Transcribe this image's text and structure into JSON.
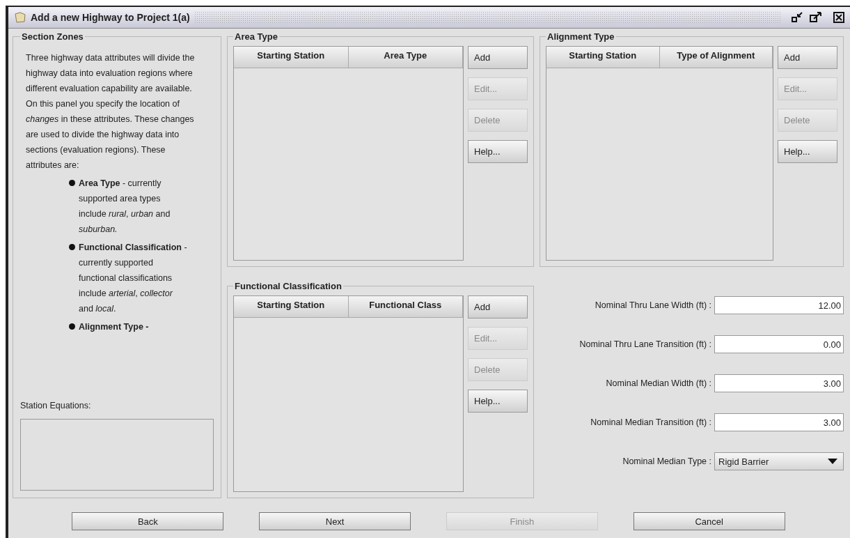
{
  "window": {
    "title": "Add a new Highway to Project 1(a)"
  },
  "section_zones": {
    "title": "Section Zones",
    "description": "Three highway data attributes will divide the highway data into evaluation regions where different evaluation capability are available. On this panel you specify the location of *changes* in these attributes. These changes are used to divide the highway data into sections (evaluation regions). These attributes are:",
    "bullets": [
      "**Area Type** - currently supported area types include *rural*, *urban* and *suburban.*",
      "**Functional Classification** - currently supported functional classifications include *arterial*, *collector* and *local*.",
      "**Alignment Type -**"
    ],
    "station_equations": {
      "label": "Station Equations:"
    }
  },
  "area_type": {
    "title": "Area Type",
    "columns": [
      "Starting Station",
      "Area Type"
    ],
    "buttons": [
      {
        "label": "Add",
        "disabled": false
      },
      {
        "label": "Edit...",
        "disabled": true
      },
      {
        "label": "Delete",
        "disabled": true
      },
      {
        "label": "Help...",
        "disabled": false
      }
    ]
  },
  "alignment_type": {
    "title": "Alignment Type",
    "columns": [
      "Starting Station",
      "Type of Alignment"
    ],
    "buttons": [
      {
        "label": "Add",
        "disabled": false
      },
      {
        "label": "Edit...",
        "disabled": true
      },
      {
        "label": "Delete",
        "disabled": true
      },
      {
        "label": "Help...",
        "disabled": false
      }
    ]
  },
  "functional_classification": {
    "title": "Functional Classification",
    "columns": [
      "Starting Station",
      "Functional Class"
    ],
    "buttons": [
      {
        "label": "Add",
        "disabled": false
      },
      {
        "label": "Edit...",
        "disabled": true
      },
      {
        "label": "Delete",
        "disabled": true
      },
      {
        "label": "Help...",
        "disabled": false
      }
    ]
  },
  "fields": [
    {
      "kind": "text",
      "label": "Nominal Thru Lane Width (ft) :",
      "value": "12.00"
    },
    {
      "kind": "text",
      "label": "Nominal Thru Lane Transition (ft) :",
      "value": "0.00"
    },
    {
      "kind": "text",
      "label": "Nominal Median Width (ft) :",
      "value": "3.00"
    },
    {
      "kind": "text",
      "label": "Nominal Median Transition (ft) :",
      "value": "3.00"
    },
    {
      "kind": "dropdown",
      "label": "Nominal Median Type :",
      "value": "Rigid Barrier"
    }
  ],
  "buttons": [
    {
      "label": "Back",
      "disabled": false
    },
    {
      "label": "Next",
      "disabled": false
    },
    {
      "label": "Finish",
      "disabled": true
    },
    {
      "label": "Cancel",
      "disabled": false
    }
  ]
}
